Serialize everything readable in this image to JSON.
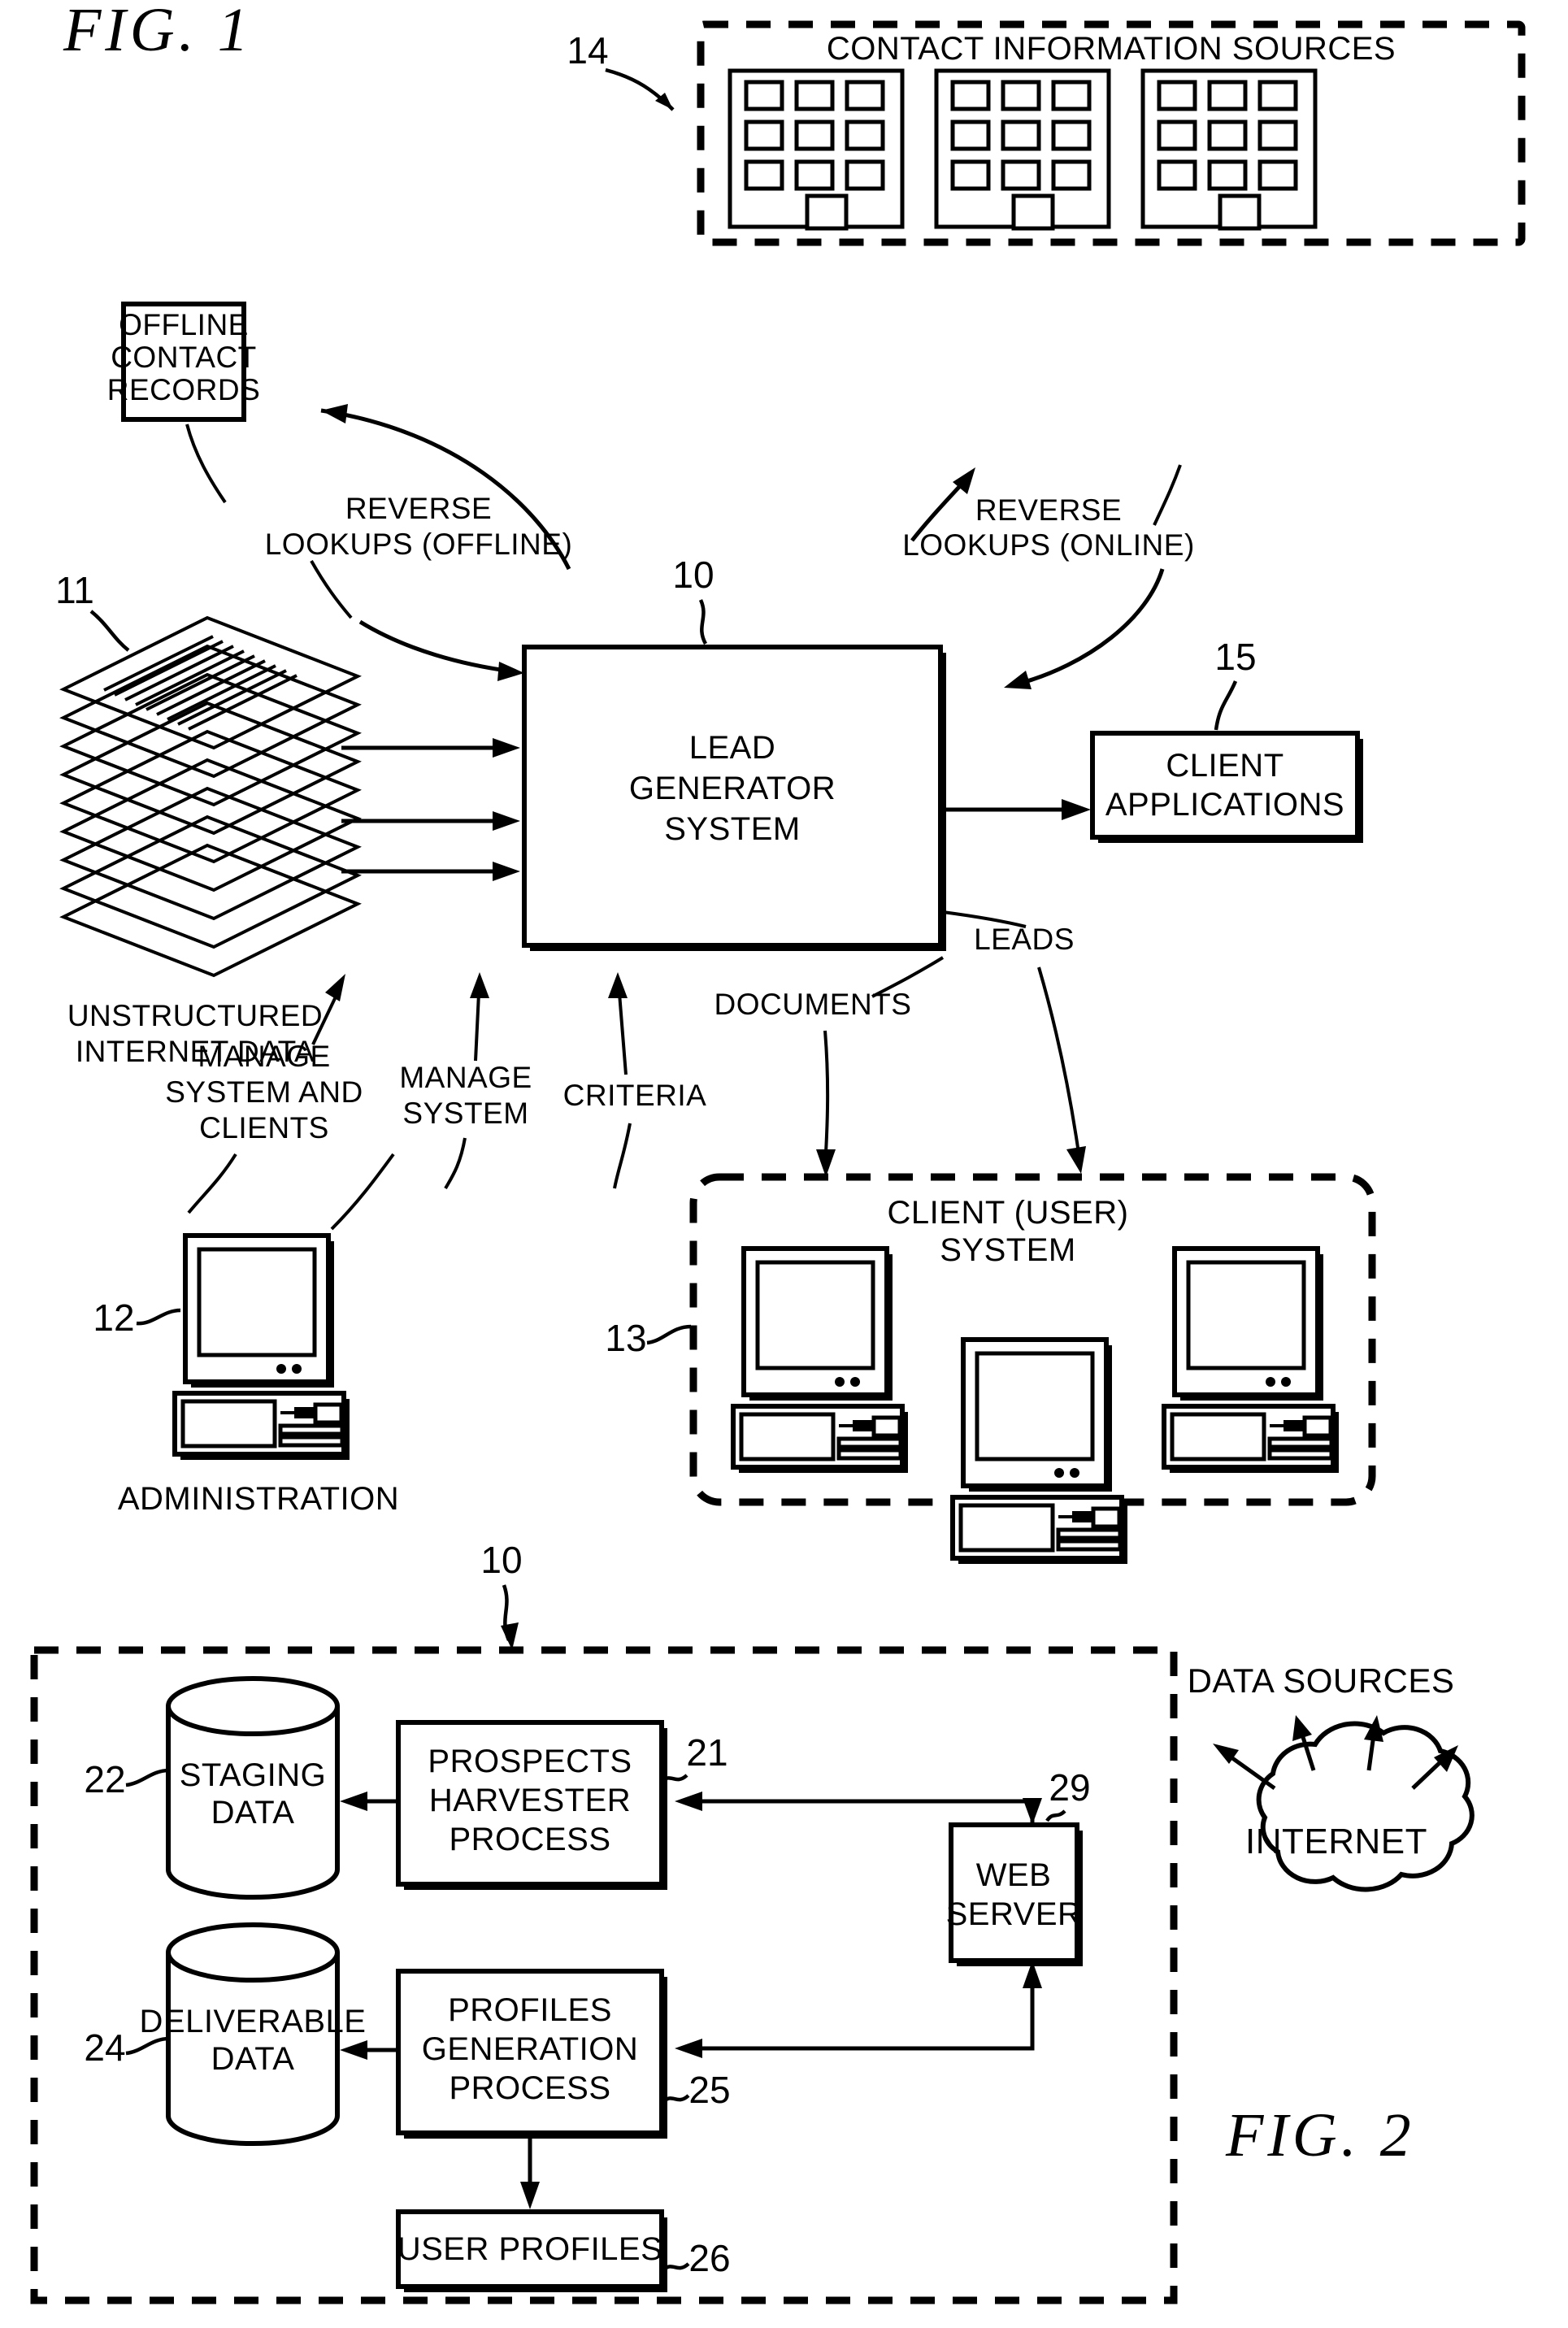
{
  "figures": [
    {
      "id": "fig1",
      "title": "FIG.  1"
    },
    {
      "id": "fig2",
      "title": "FIG.  2"
    }
  ],
  "fig1": {
    "title": "FIG.  1",
    "contact_sources": {
      "ref": "14",
      "label": "CONTACT INFORMATION SOURCES",
      "building_count": 3,
      "windows_per_building": 9
    },
    "offline_records": {
      "lines": [
        "OFFLINE",
        "CONTACT",
        "RECORDS"
      ]
    },
    "lead_generator": {
      "ref": "10",
      "lines": [
        "LEAD",
        "GENERATOR",
        "SYSTEM"
      ]
    },
    "client_applications": {
      "ref": "15",
      "lines": [
        "CLIENT",
        "APPLICATIONS"
      ]
    },
    "unstructured_data": {
      "ref": "11",
      "lines": [
        "UNSTRUCTURED",
        "INTERNET DATA"
      ]
    },
    "administration": {
      "ref": "12",
      "label": "ADMINISTRATION"
    },
    "client_system": {
      "ref": "13",
      "lines": [
        "CLIENT (USER)",
        "SYSTEM"
      ],
      "computer_count": 3
    },
    "edge_labels": {
      "reverse_offline": [
        "REVERSE",
        "LOOKUPS (OFFLINE)"
      ],
      "reverse_online": [
        "REVERSE",
        "LOOKUPS (ONLINE)"
      ],
      "manage_system_clients": [
        "MANAGE",
        "SYSTEM AND",
        "CLIENTS"
      ],
      "manage_system": [
        "MANAGE",
        "SYSTEM"
      ],
      "criteria": "CRITERIA",
      "documents": "DOCUMENTS",
      "leads": "LEADS"
    }
  },
  "fig2": {
    "title": "FIG.  2",
    "system_ref": "10",
    "staging_data": {
      "ref": "22",
      "lines": [
        "STAGING",
        "DATA"
      ]
    },
    "deliverable_data": {
      "ref": "24",
      "lines": [
        "DELIVERABLE",
        "DATA"
      ]
    },
    "prospects_harvester": {
      "ref": "21",
      "lines": [
        "PROSPECTS",
        "HARVESTER",
        "PROCESS"
      ]
    },
    "profiles_generation": {
      "ref": "25",
      "lines": [
        "PROFILES",
        "GENERATION",
        "PROCESS"
      ]
    },
    "web_server": {
      "ref": "29",
      "lines": [
        "WEB",
        "SERVER"
      ]
    },
    "user_profiles": {
      "ref": "26",
      "label": "USER PROFILES"
    },
    "internet": {
      "label": "INTERNET",
      "caption": "DATA SOURCES",
      "arrow_count": 4
    }
  },
  "colors": {
    "ink": "#000000",
    "paper": "#ffffff"
  }
}
